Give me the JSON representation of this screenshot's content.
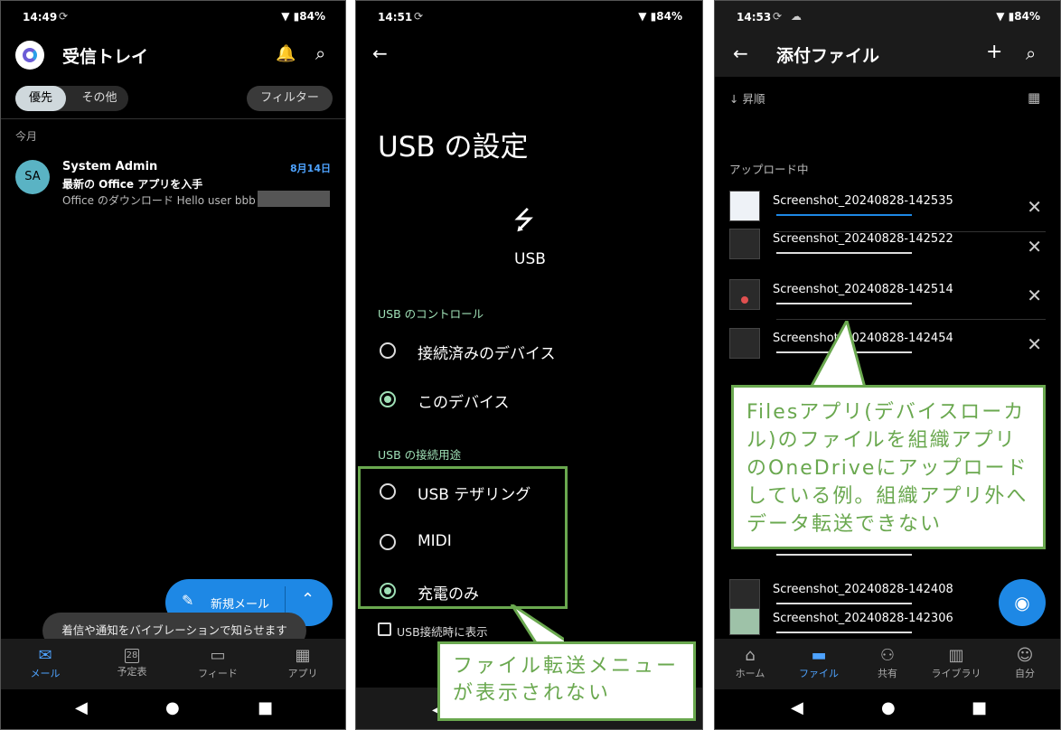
{
  "colors": {
    "accent": "#1e88e5",
    "green": "#6aa84f",
    "radio_green": "#9fe0b6"
  },
  "phone1": {
    "status": {
      "time": "14:49",
      "battery": "84%"
    },
    "title": "受信トレイ",
    "chips": {
      "focused": "優先",
      "other": "その他",
      "filter": "フィルター"
    },
    "section": "今月",
    "email": {
      "avatar": "SA",
      "sender": "System Admin",
      "date": "8月14日",
      "subject": "最新の Office アプリを入手",
      "preview": "Office のダウンロード Hello user bbb"
    },
    "fab": {
      "label": "新規メール"
    },
    "toast": "着信や通知をバイブレーションで知らせます",
    "tabs": [
      "メール",
      "予定表",
      "フィード",
      "アプリ"
    ],
    "calendar_day": "28"
  },
  "phone2": {
    "status": {
      "time": "14:51",
      "battery": "84%"
    },
    "title": "USB の設定",
    "usb_label": "USB",
    "section_control": "USB のコントロール",
    "opt_connected": "接続済みのデバイス",
    "opt_this": "このデバイス",
    "section_use": "USB の接続用途",
    "opt_tether": "USB テザリング",
    "opt_midi": "MIDI",
    "opt_charge": "充電のみ",
    "checkbox_label": "USB接続時に表示",
    "callout": "ファイル転送メニューが表示されない"
  },
  "phone3": {
    "status": {
      "time": "14:53",
      "battery": "84%"
    },
    "title": "添付ファイル",
    "sort": "昇順",
    "section": "アップロード中",
    "files": [
      "Screenshot_20240828-142535",
      "Screenshot_20240828-142522",
      "Screenshot_20240828-142514",
      "Screenshot_20240828-142454",
      "Screenshot_20240828-142408",
      "Screenshot_20240828-142306"
    ],
    "tabs": [
      "ホーム",
      "ファイル",
      "共有",
      "ライブラリ",
      "自分"
    ],
    "callout": "Filesアプリ(デバイスローカル)のファイルを組織アプリのOneDriveにアップロードしている例。組織アプリ外へデータ転送できない"
  }
}
